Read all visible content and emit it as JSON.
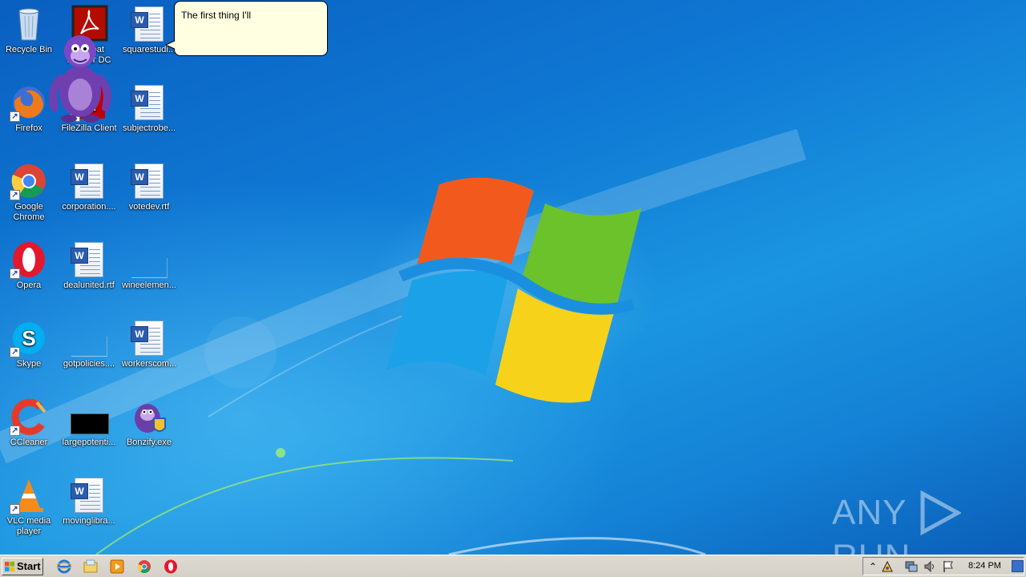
{
  "desktop": {
    "icons": [
      {
        "label": "Recycle Bin",
        "icon": "recycle-bin-icon"
      },
      {
        "label": "Firefox",
        "icon": "firefox-icon"
      },
      {
        "label": "Google Chrome",
        "icon": "chrome-icon"
      },
      {
        "label": "Opera",
        "icon": "opera-icon"
      },
      {
        "label": "Skype",
        "icon": "skype-icon"
      },
      {
        "label": "CCleaner",
        "icon": "ccleaner-icon"
      },
      {
        "label": "VLC media player",
        "icon": "vlc-icon"
      },
      {
        "label": "Acrobat Reader DC",
        "icon": "acrobat-icon"
      },
      {
        "label": "FileZilla Client",
        "icon": "filezilla-icon"
      },
      {
        "label": "corporation....",
        "icon": "word-doc-icon"
      },
      {
        "label": "dealunited.rtf",
        "icon": "word-doc-icon"
      },
      {
        "label": "gotpolicies....",
        "icon": "blank-file-icon"
      },
      {
        "label": "largepotenti...",
        "icon": "black-image-icon"
      },
      {
        "label": "movinglibra...",
        "icon": "word-doc-icon"
      },
      {
        "label": "squarestudi...",
        "icon": "word-doc-icon"
      },
      {
        "label": "subjectrobe...",
        "icon": "word-doc-icon"
      },
      {
        "label": "votedev.rtf",
        "icon": "word-doc-icon"
      },
      {
        "label": "wineelemen...",
        "icon": "blank-file-icon"
      },
      {
        "label": "workerscom...",
        "icon": "word-doc-icon"
      },
      {
        "label": "Bonzify.exe",
        "icon": "bonzi-exe-icon"
      }
    ]
  },
  "bonzi": {
    "speech": "The first thing I'll"
  },
  "watermark": {
    "text_left": "ANY",
    "text_right": "RUN"
  },
  "taskbar": {
    "start_label": "Start",
    "pinned": [
      "internet-explorer-icon",
      "windows-explorer-icon",
      "media-player-icon",
      "chrome-icon",
      "opera-icon"
    ],
    "tray_icons": [
      "show-hidden-icons",
      "bonzi-tray-icon",
      "network-icon",
      "volume-icon",
      "action-center-flag-icon"
    ],
    "clock": "8:24 PM"
  },
  "colors": {
    "desktop_blue": "#1482d6",
    "taskbar": "#d4d0c8",
    "bubble": "#ffffe1"
  }
}
